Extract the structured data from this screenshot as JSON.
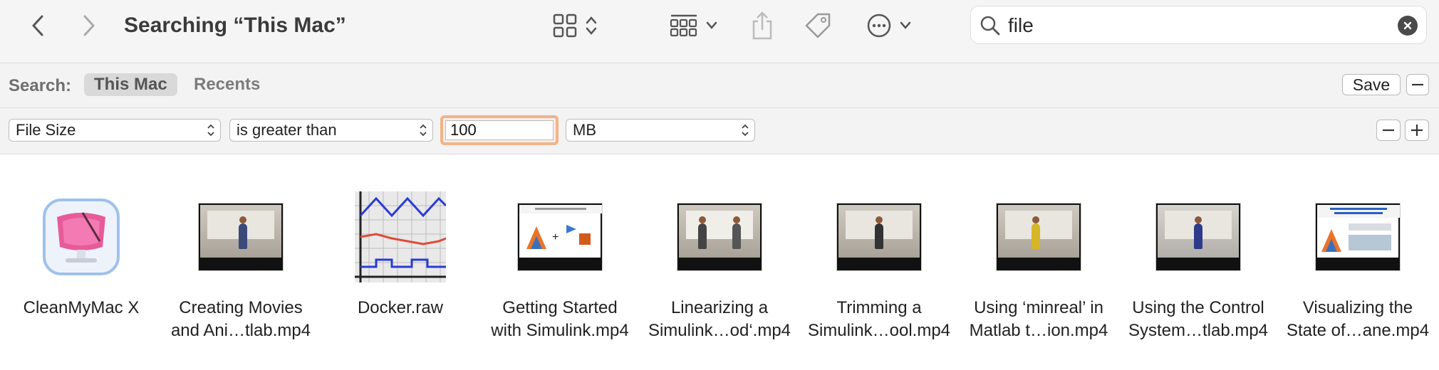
{
  "toolbar": {
    "title": "Searching “This Mac”",
    "back_icon": "chevron-left-icon",
    "forward_icon": "chevron-right-icon",
    "view_icon": "icon-grid-icon",
    "group_icon": "group-grid-icon",
    "share_icon": "share-icon",
    "tag_icon": "tag-icon",
    "more_icon": "ellipsis-circle-icon"
  },
  "search": {
    "query": "file"
  },
  "scope": {
    "label": "Search:",
    "options": [
      "This Mac",
      "Recents"
    ],
    "selected": "This Mac",
    "save_label": "Save"
  },
  "rule": {
    "attribute": "File Size",
    "operator": "is greater than",
    "value": "100",
    "unit": "MB"
  },
  "results": [
    {
      "line1": "CleanMyMac X",
      "line2": "",
      "kind": "app"
    },
    {
      "line1": "Creating Movies",
      "line2": "and Ani…tlab.mp4",
      "kind": "video"
    },
    {
      "line1": "Docker.raw",
      "line2": "",
      "kind": "raw"
    },
    {
      "line1": "Getting Started",
      "line2": "with Simulink.mp4",
      "kind": "slide"
    },
    {
      "line1": "Linearizing a",
      "line2": "Simulink…od‘.mp4",
      "kind": "video"
    },
    {
      "line1": "Trimming a",
      "line2": "Simulink…ool.mp4",
      "kind": "video"
    },
    {
      "line1": "Using ‘minreal’ in",
      "line2": "Matlab t…ion.mp4",
      "kind": "video"
    },
    {
      "line1": "Using the Control",
      "line2": "System…tlab.mp4",
      "kind": "video"
    },
    {
      "line1": "Visualizing the",
      "line2": "State of…ane.mp4",
      "kind": "slide"
    }
  ],
  "colors": {
    "accent_focus": "#f1b48a",
    "toolbar_bg": "#f6f5f5",
    "bar_bg": "#f3f3f3"
  }
}
